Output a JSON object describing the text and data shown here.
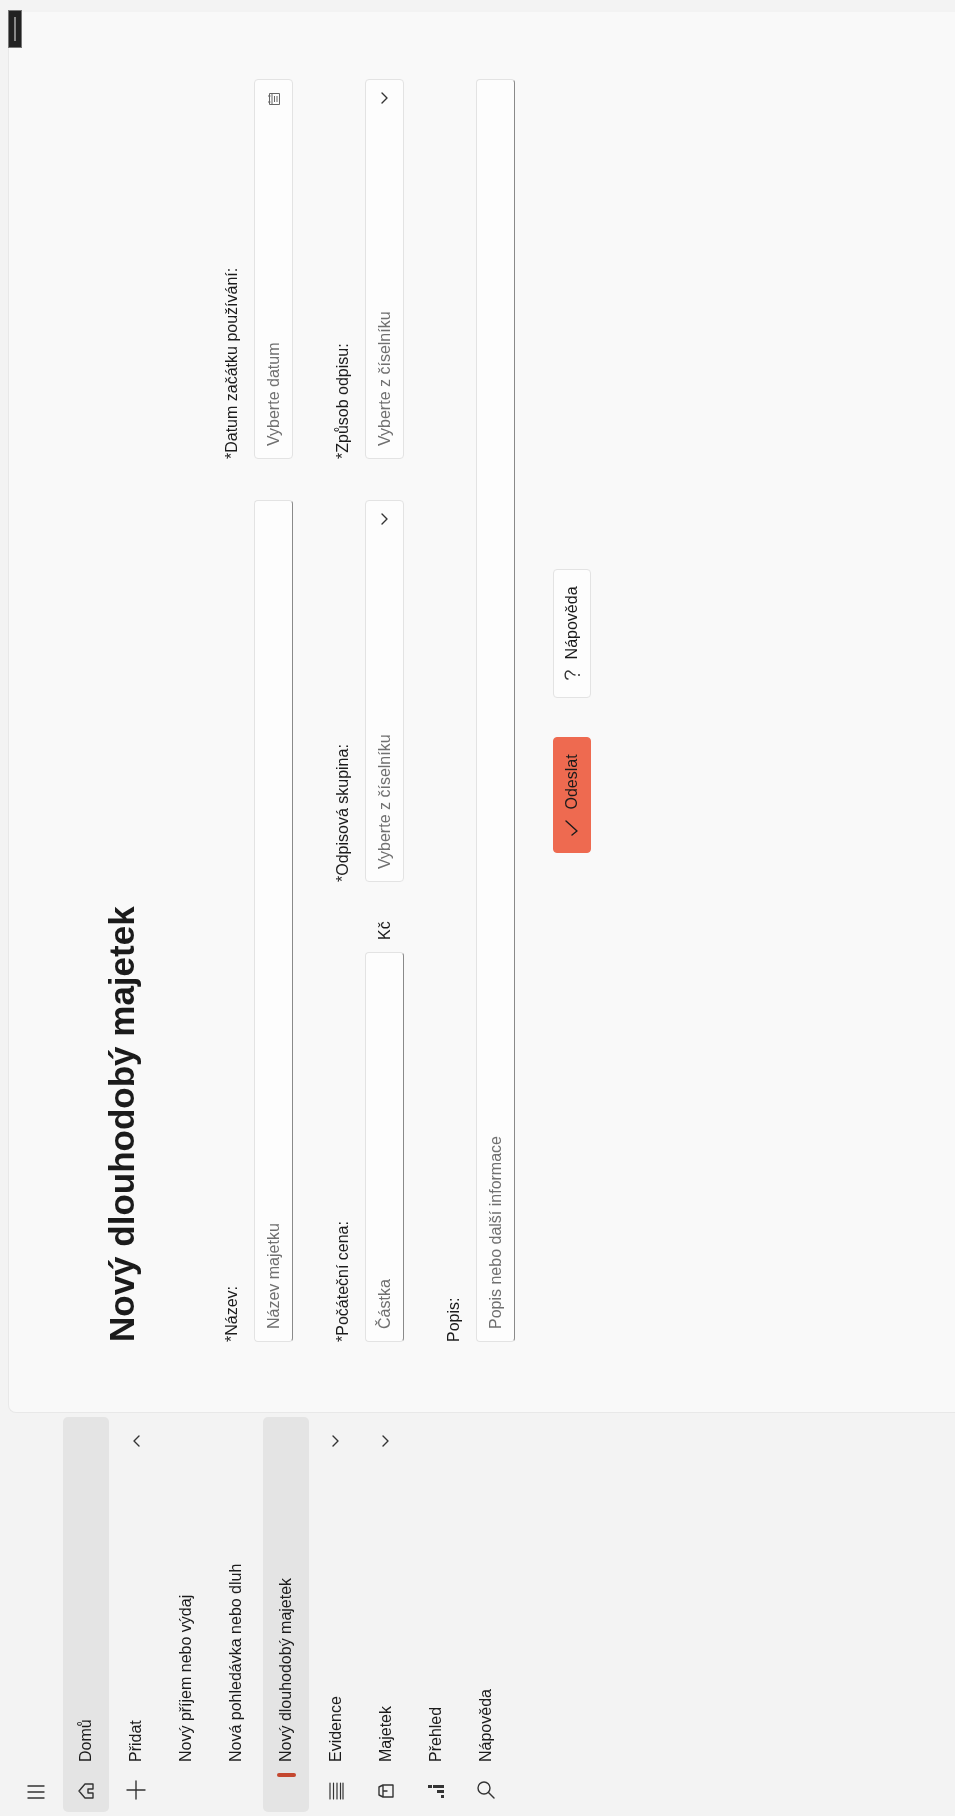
{
  "title": "Nový dlouhodobý majetek",
  "sidebar": {
    "items": [
      {
        "label": "Domů",
        "selected": false,
        "highlighted": true
      },
      {
        "label": "Přidat",
        "selected": false,
        "highlighted": false,
        "expanded": true,
        "children": [
          {
            "label": "Nový příjem nebo výdaj",
            "selected": false,
            "highlighted": false
          },
          {
            "label": "Nová pohledávka nebo dluh",
            "selected": false,
            "highlighted": false
          },
          {
            "label": "Nový dlouhodobý majetek",
            "selected": true,
            "highlighted": true
          }
        ]
      },
      {
        "label": "Evidence",
        "selected": false,
        "highlighted": false,
        "expanded": false
      },
      {
        "label": "Majetek",
        "selected": false,
        "highlighted": false,
        "expanded": false
      },
      {
        "label": "Přehled",
        "selected": false,
        "highlighted": false
      },
      {
        "label": "Nápověda",
        "selected": false,
        "highlighted": false
      }
    ]
  },
  "form": {
    "fields": [
      {
        "kind": "text",
        "label": "*Název:",
        "placeholder": "Název majetku"
      },
      {
        "kind": "date",
        "label": "*Datum začátku používání:",
        "placeholder": "Vyberte datum"
      },
      {
        "kind": "amount",
        "label": "*Počáteční cena:",
        "placeholder": "Částka",
        "unit": "Kč"
      },
      {
        "kind": "select",
        "label": "*Odpisová skupina:",
        "placeholder": "Vyberte z číselníku"
      },
      {
        "kind": "select",
        "label": "*Způsob odpisu:",
        "placeholder": "Vyberte z číselníku"
      },
      {
        "kind": "textarea",
        "label": "Popis:",
        "placeholder": "Popis nebo další informace"
      }
    ],
    "buttons": [
      {
        "kind": "primary",
        "label": "Odeslat"
      },
      {
        "kind": "help",
        "label": "Nápověda"
      }
    ]
  }
}
